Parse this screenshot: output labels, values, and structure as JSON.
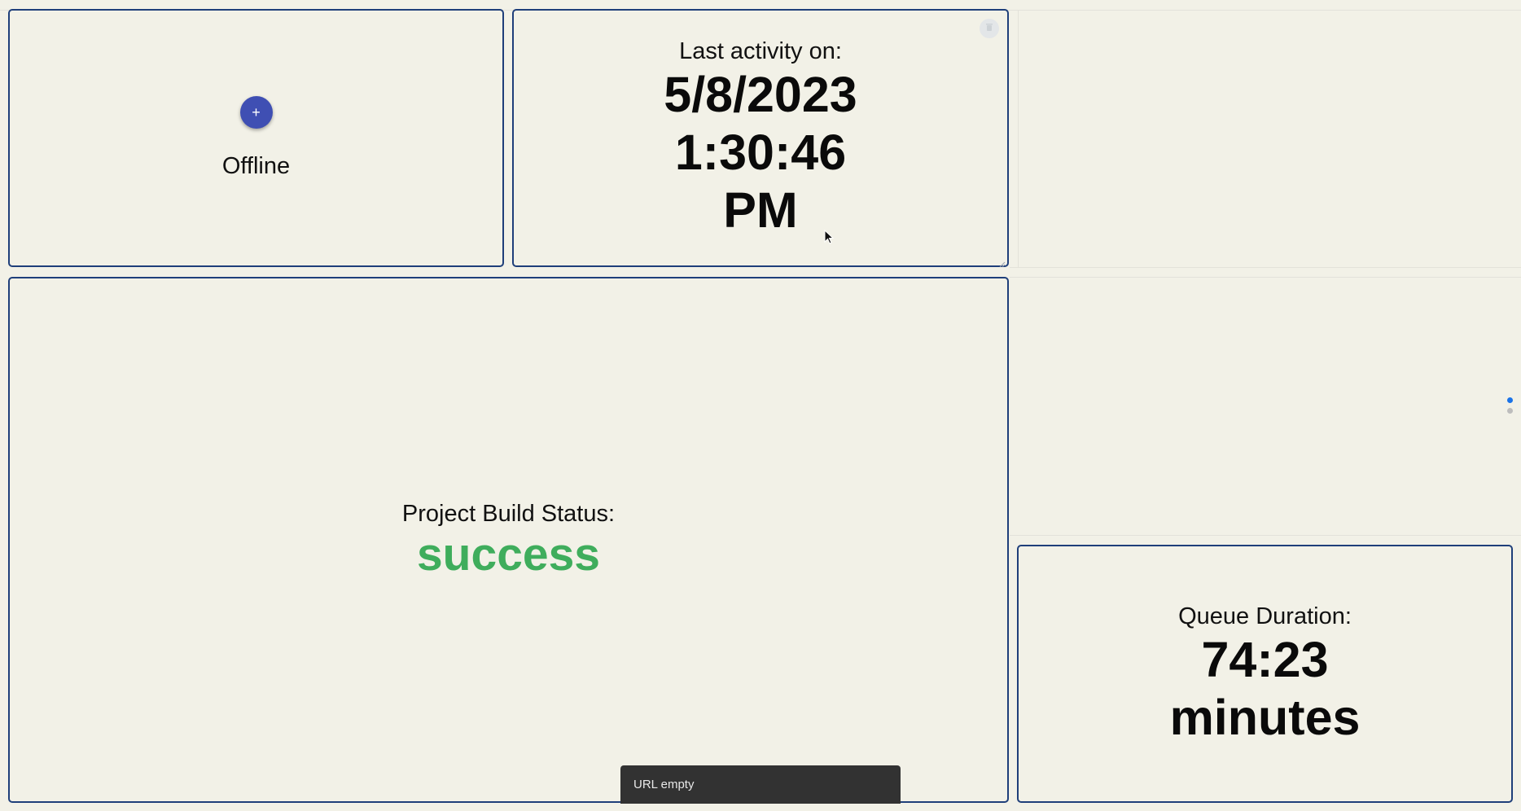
{
  "tiles": {
    "offline": {
      "add_button_symbol": "+",
      "status_text": "Offline"
    },
    "last_activity": {
      "label": "Last activity on:",
      "date": "5/8/2023",
      "time": "1:30:46",
      "meridiem": "PM"
    },
    "build_status": {
      "label": "Project Build Status:",
      "value": "success",
      "value_color": "#3fad5c"
    },
    "queue_duration": {
      "label": "Queue Duration:",
      "value": "74:23",
      "unit": "minutes"
    }
  },
  "snackbar": {
    "message": "URL empty"
  },
  "page_indicator": {
    "pages": 2,
    "active_index": 0,
    "active_color": "#1a73e8",
    "inactive_color": "#bdbdbd"
  },
  "colors": {
    "tile_border": "#1f3f7a",
    "background": "#f2f1e7",
    "fab": "#3f4fb3"
  },
  "icons": {
    "fab": "plus-icon",
    "delete": "delete-icon",
    "resize": "resize-handle-icon",
    "cursor": "mouse-pointer-icon"
  }
}
